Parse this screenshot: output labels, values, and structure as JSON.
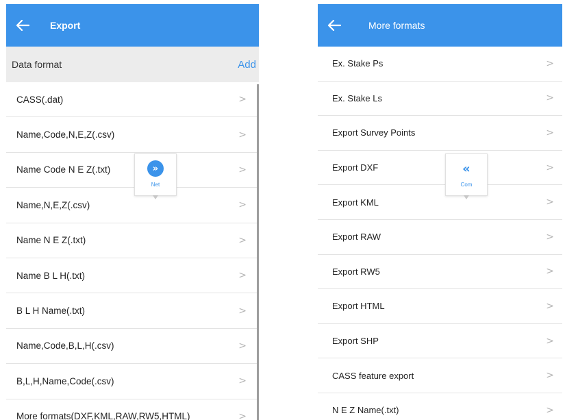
{
  "colors": {
    "primary": "#3b93ea",
    "header_bg": "#ececec",
    "chevron": "#b5b5b5"
  },
  "left": {
    "title": "Export",
    "back_icon": "arrow-left-icon",
    "section_label": "Data format",
    "add_label": "Add",
    "items": [
      {
        "label": "CASS(.dat)"
      },
      {
        "label": "Name,Code,N,E,Z(.csv)"
      },
      {
        "label": "Name Code N E Z(.txt)"
      },
      {
        "label": "Name,N,E,Z(.csv)"
      },
      {
        "label": "Name N E Z(.txt)"
      },
      {
        "label": "Name B L H(.txt)"
      },
      {
        "label": "B L H Name(.txt)"
      },
      {
        "label": "Name,Code,B,L,H(.csv)"
      },
      {
        "label": "B,L,H,Name,Code(.csv)"
      },
      {
        "label": "More formats(DXF,KML,RAW,RW5,HTML)"
      }
    ],
    "chevron": ">",
    "floater": {
      "icon": "double-chevron-right-icon",
      "glyph": "»",
      "label": "Net"
    }
  },
  "right": {
    "title": "More formats",
    "back_icon": "arrow-left-icon",
    "items": [
      {
        "label": "Ex. Stake Ps"
      },
      {
        "label": "Ex. Stake Ls"
      },
      {
        "label": "Export Survey Points"
      },
      {
        "label": "Export DXF"
      },
      {
        "label": "Export KML"
      },
      {
        "label": "Export RAW"
      },
      {
        "label": "Export RW5"
      },
      {
        "label": "Export HTML"
      },
      {
        "label": "Export SHP"
      },
      {
        "label": "CASS feature export"
      },
      {
        "label": "N E Z Name(.txt)"
      }
    ],
    "chevron": ">",
    "floater": {
      "icon": "double-chevron-left-icon",
      "glyph": "«",
      "label": "Com"
    }
  }
}
